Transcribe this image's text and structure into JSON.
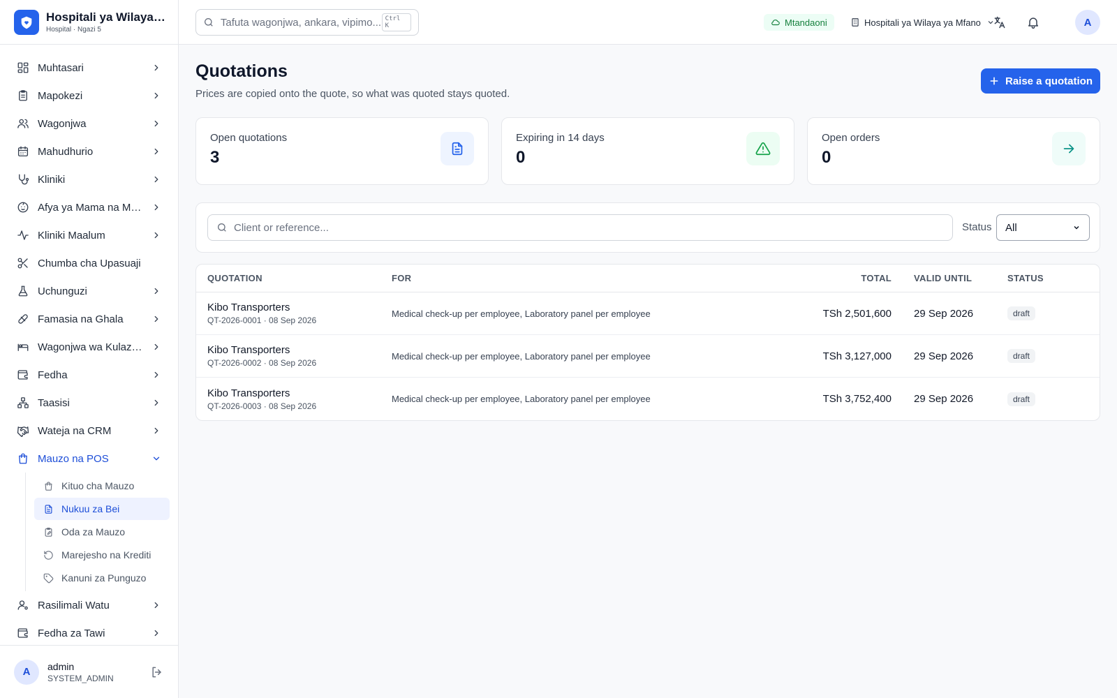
{
  "brand": {
    "title": "Hospitali ya Wilaya ya Mfano",
    "subtitle": "Hospital · Ngazi 5"
  },
  "sidebar": {
    "items": [
      {
        "label": "Muhtasari",
        "icon": "dashboard-icon"
      },
      {
        "label": "Mapokezi",
        "icon": "clipboard-icon"
      },
      {
        "label": "Wagonjwa",
        "icon": "users-icon"
      },
      {
        "label": "Mahudhurio",
        "icon": "calendar-icon"
      },
      {
        "label": "Kliniki",
        "icon": "stethoscope-icon"
      },
      {
        "label": "Afya ya Mama na Mtoto",
        "icon": "baby-icon"
      },
      {
        "label": "Kliniki Maalum",
        "icon": "activity-icon"
      },
      {
        "label": "Chumba cha Upasuaji",
        "icon": "scissors-icon"
      },
      {
        "label": "Uchunguzi",
        "icon": "flask-icon"
      },
      {
        "label": "Famasia na Ghala",
        "icon": "pill-icon"
      },
      {
        "label": "Wagonjwa wa Kulazwa",
        "icon": "bed-icon"
      },
      {
        "label": "Fedha",
        "icon": "wallet-icon"
      },
      {
        "label": "Taasisi",
        "icon": "network-icon"
      },
      {
        "label": "Wateja na CRM",
        "icon": "handshake-icon"
      },
      {
        "label": "Mauzo na POS",
        "icon": "shopping-bag-icon"
      }
    ],
    "subitems": [
      {
        "label": "Kituo cha Mauzo",
        "icon": "shopping-bag-icon"
      },
      {
        "label": "Nukuu za Bei",
        "icon": "file-text-icon"
      },
      {
        "label": "Oda za Mauzo",
        "icon": "clipboard-edit-icon"
      },
      {
        "label": "Marejesho na Krediti",
        "icon": "rotate-ccw-icon"
      },
      {
        "label": "Kanuni za Punguzo",
        "icon": "tag-icon"
      }
    ],
    "after_items": [
      {
        "label": "Rasilimali Watu",
        "icon": "user-cog-icon"
      },
      {
        "label": "Fedha za Tawi",
        "icon": "wallet-icon"
      }
    ]
  },
  "user": {
    "initial": "A",
    "name": "admin",
    "role": "SYSTEM_ADMIN"
  },
  "topbar": {
    "search_placeholder": "Tafuta wagonjwa, ankara, vipimo...",
    "shortcut": "Ctrl K",
    "online_label": "Mtandaoni",
    "facility_label": "Hospitali ya Wilaya ya Mfano",
    "avatar_initial": "A"
  },
  "page": {
    "title": "Quotations",
    "subtitle": "Prices are copied onto the quote, so what was quoted stays quoted.",
    "raise_button": "Raise a quotation"
  },
  "stats": [
    {
      "label": "Open quotations",
      "value": "3",
      "icon": "file-text-icon",
      "color": "#2563eb",
      "bg": "#eef4ff"
    },
    {
      "label": "Expiring in 14 days",
      "value": "0",
      "icon": "alert-triangle-icon",
      "color": "#16a34a",
      "bg": "#ecfdf3"
    },
    {
      "label": "Open orders",
      "value": "0",
      "icon": "arrow-right-icon",
      "color": "#0d9488",
      "bg": "#effcf9"
    }
  ],
  "filter": {
    "search_placeholder": "Client or reference...",
    "status_label": "Status",
    "status_value": "All"
  },
  "table": {
    "headers": {
      "quotation": "QUOTATION",
      "for": "FOR",
      "total": "TOTAL",
      "valid_until": "VALID UNTIL",
      "status": "STATUS"
    },
    "rows": [
      {
        "client": "Kibo Transporters",
        "ref": "QT-2026-0001 · 08 Sep 2026",
        "for": "Medical check-up per employee, Laboratory panel per employee",
        "total": "TSh 2,501,600",
        "valid_until": "29 Sep 2026",
        "status": "draft"
      },
      {
        "client": "Kibo Transporters",
        "ref": "QT-2026-0002 · 08 Sep 2026",
        "for": "Medical check-up per employee, Laboratory panel per employee",
        "total": "TSh 3,127,000",
        "valid_until": "29 Sep 2026",
        "status": "draft"
      },
      {
        "client": "Kibo Transporters",
        "ref": "QT-2026-0003 · 08 Sep 2026",
        "for": "Medical check-up per employee, Laboratory panel per employee",
        "total": "TSh 3,752,400",
        "valid_until": "29 Sep 2026",
        "status": "draft"
      }
    ]
  }
}
